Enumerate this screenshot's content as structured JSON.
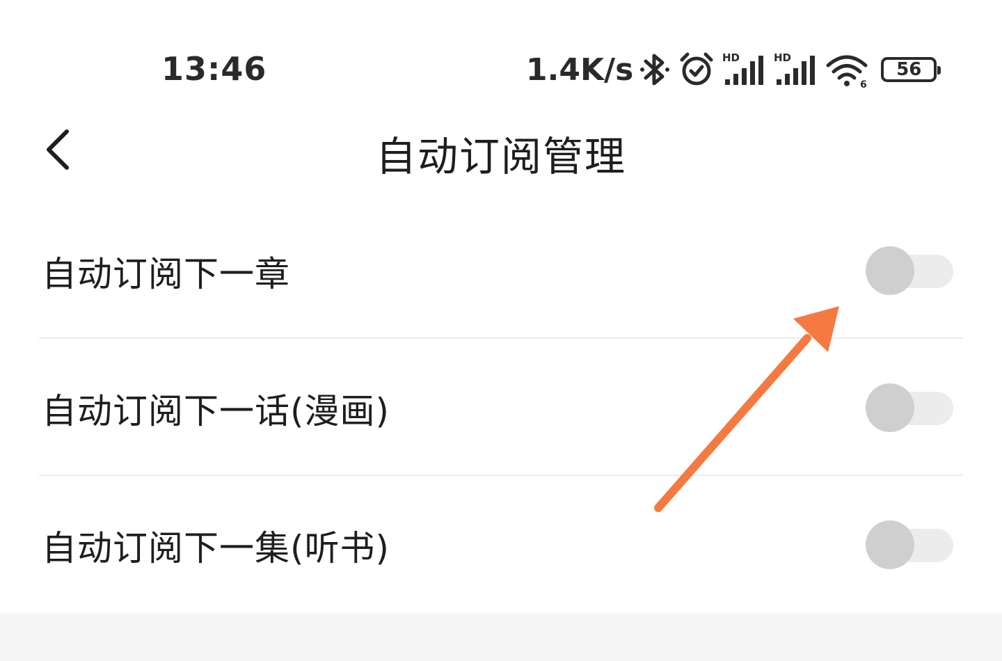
{
  "status_bar": {
    "time": "13:46",
    "net_speed": "1.4K/s",
    "battery_level": "56",
    "icons": [
      "bluetooth-icon",
      "alarm-icon",
      "signal-hd-icon",
      "signal-hd-icon",
      "wifi-icon",
      "battery-icon"
    ]
  },
  "nav": {
    "back_icon": "chevron-left-icon",
    "title": "自动订阅管理"
  },
  "settings": [
    {
      "label": "自动订阅下一章",
      "enabled": false
    },
    {
      "label": "自动订阅下一话(漫画)",
      "enabled": false
    },
    {
      "label": "自动订阅下一集(听书)",
      "enabled": false
    }
  ],
  "colors": {
    "toggle_knob": "#cfcfcf",
    "toggle_track": "#ececec",
    "annotation_arrow": "#f47a42"
  }
}
